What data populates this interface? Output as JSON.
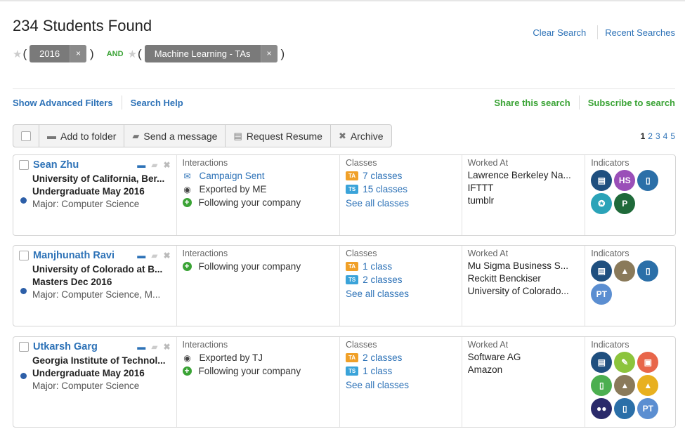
{
  "header": {
    "title": "234 Students Found",
    "clear_search": "Clear Search",
    "recent_searches": "Recent Searches"
  },
  "filters": {
    "chips": [
      {
        "label": "2016",
        "remove": "×"
      },
      {
        "label": "Machine Learning - TAs",
        "remove": "×"
      }
    ],
    "operator": "AND",
    "open_paren": "(",
    "close_paren": ")",
    "star": "★"
  },
  "links": {
    "advanced_filters": "Show Advanced Filters",
    "search_help": "Search Help",
    "share": "Share this search",
    "subscribe": "Subscribe to search"
  },
  "toolbar": {
    "add_to_folder": "Add to folder",
    "send_message": "Send a message",
    "request_resume": "Request Resume",
    "archive": "Archive"
  },
  "pagination": {
    "current": "1",
    "pages": [
      "2",
      "3",
      "4",
      "5"
    ]
  },
  "column_headers": {
    "interactions": "Interactions",
    "classes": "Classes",
    "worked_at": "Worked At",
    "indicators": "Indicators"
  },
  "students": [
    {
      "name": "Sean Zhu",
      "university": "University of California, Ber...",
      "grad": "Undergraduate May 2016",
      "major": "Major: Computer Science",
      "interactions": [
        {
          "icon": "envelope-icon",
          "text": "Campaign Sent",
          "link": true
        },
        {
          "icon": "eye-icon",
          "text": "Exported by ME",
          "link": false
        },
        {
          "icon": "plus-icon",
          "text": "Following your company",
          "link": false
        }
      ],
      "classes": [
        {
          "badge": "TA",
          "text": "7 classes"
        },
        {
          "badge": "TS",
          "text": "15 classes"
        }
      ],
      "see_all": "See all classes",
      "worked_at": [
        "Lawrence Berkeley Na...",
        "IFTTT",
        "tumblr"
      ],
      "indicators": [
        {
          "name": "document-icon",
          "label": "▤",
          "color": "#1f4f7f"
        },
        {
          "name": "hs-badge",
          "label": "HS",
          "color": "#9a4fb8"
        },
        {
          "name": "locker-icon",
          "label": "▯",
          "color": "#2b6fa8"
        },
        {
          "name": "award-icon",
          "label": "✪",
          "color": "#2ba3b8"
        },
        {
          "name": "p-badge",
          "label": "P",
          "color": "#1f6a3a"
        }
      ]
    },
    {
      "name": "Manjhunath Ravi",
      "university": "University of Colorado at B...",
      "grad": "Masters Dec 2016",
      "major": "Major: Computer Science, M...",
      "interactions": [
        {
          "icon": "plus-icon",
          "text": "Following your company",
          "link": false
        }
      ],
      "classes": [
        {
          "badge": "TA",
          "text": "1 class"
        },
        {
          "badge": "TS",
          "text": "2 classes"
        }
      ],
      "see_all": "See all classes",
      "worked_at": [
        "Mu Sigma Business S...",
        "Reckitt Benckiser",
        "University of Colorado..."
      ],
      "indicators": [
        {
          "name": "document-icon",
          "label": "▤",
          "color": "#1f4f7f"
        },
        {
          "name": "mountain-icon",
          "label": "▲",
          "color": "#8a7a5a"
        },
        {
          "name": "locker-icon",
          "label": "▯",
          "color": "#2b6fa8"
        },
        {
          "name": "pt-badge",
          "label": "PT",
          "color": "#5b8ed1"
        }
      ]
    },
    {
      "name": "Utkarsh Garg",
      "university": "Georgia Institute of Technol...",
      "grad": "Undergraduate May 2016",
      "major": "Major: Computer Science",
      "interactions": [
        {
          "icon": "eye-icon",
          "text": "Exported by TJ",
          "link": false
        },
        {
          "icon": "plus-icon",
          "text": "Following your company",
          "link": false
        }
      ],
      "classes": [
        {
          "badge": "TA",
          "text": "2 classes"
        },
        {
          "badge": "TS",
          "text": "1 class"
        }
      ],
      "see_all": "See all classes",
      "worked_at": [
        "Software AG",
        "Amazon"
      ],
      "indicators": [
        {
          "name": "document-icon",
          "label": "▤",
          "color": "#1f4f7f"
        },
        {
          "name": "leaf-icon",
          "label": "✎",
          "color": "#8cc43c"
        },
        {
          "name": "presentation-icon",
          "label": "▣",
          "color": "#e8664a"
        },
        {
          "name": "phone-icon",
          "label": "▯",
          "color": "#4caf50"
        },
        {
          "name": "mountain-icon",
          "label": "▲",
          "color": "#8a7a5a"
        },
        {
          "name": "mountain-gold-icon",
          "label": "▲",
          "color": "#e8b020"
        },
        {
          "name": "group-icon",
          "label": "●●",
          "color": "#2a2a6a"
        },
        {
          "name": "locker-icon",
          "label": "▯",
          "color": "#2b6fa8"
        },
        {
          "name": "pt-badge",
          "label": "PT",
          "color": "#5b8ed1"
        }
      ]
    }
  ]
}
